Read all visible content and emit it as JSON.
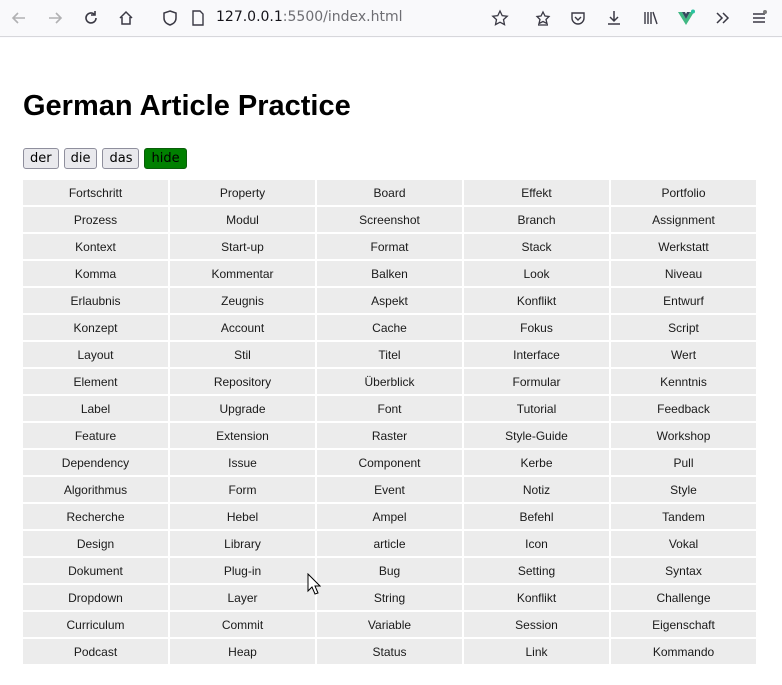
{
  "browser": {
    "url_host": "127.0.0.1",
    "url_rest": ":5500/index.html"
  },
  "page": {
    "title": "German Article Practice",
    "buttons": [
      "der",
      "die",
      "das",
      "hide"
    ]
  },
  "words": [
    "Fortschritt",
    "Property",
    "Board",
    "Effekt",
    "Portfolio",
    "Prozess",
    "Modul",
    "Screenshot",
    "Branch",
    "Assignment",
    "Kontext",
    "Start-up",
    "Format",
    "Stack",
    "Werkstatt",
    "Komma",
    "Kommentar",
    "Balken",
    "Look",
    "Niveau",
    "Erlaubnis",
    "Zeugnis",
    "Aspekt",
    "Konflikt",
    "Entwurf",
    "Konzept",
    "Account",
    "Cache",
    "Fokus",
    "Script",
    "Layout",
    "Stil",
    "Titel",
    "Interface",
    "Wert",
    "Element",
    "Repository",
    "Überblick",
    "Formular",
    "Kenntnis",
    "Label",
    "Upgrade",
    "Font",
    "Tutorial",
    "Feedback",
    "Feature",
    "Extension",
    "Raster",
    "Style-Guide",
    "Workshop",
    "Dependency",
    "Issue",
    "Component",
    "Kerbe",
    "Pull",
    "Algorithmus",
    "Form",
    "Event",
    "Notiz",
    "Style",
    "Recherche",
    "Hebel",
    "Ampel",
    "Befehl",
    "Tandem",
    "Design",
    "Library",
    "article",
    "Icon",
    "Vokal",
    "Dokument",
    "Plug-in",
    "Bug",
    "Setting",
    "Syntax",
    "Dropdown",
    "Layer",
    "String",
    "Konflikt",
    "Challenge",
    "Curriculum",
    "Commit",
    "Variable",
    "Session",
    "Eigenschaft",
    "Podcast",
    "Heap",
    "Status",
    "Link",
    "Kommando"
  ],
  "colors": {
    "hide_button": "#008000",
    "cell_bg": "#ececec"
  }
}
